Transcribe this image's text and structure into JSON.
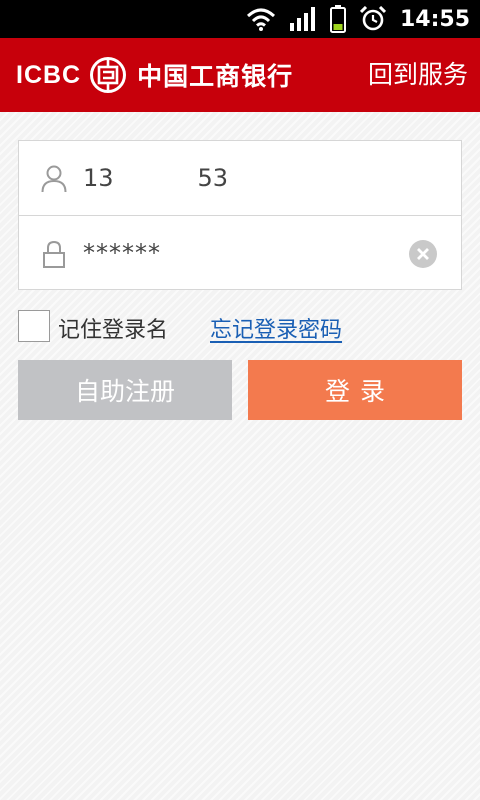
{
  "status_bar": {
    "time": "14:55",
    "icons": [
      "wifi-icon",
      "signal-icon",
      "battery-icon",
      "alarm-icon"
    ]
  },
  "header": {
    "brand_latin": "ICBC",
    "brand_logo": "icbc-logo-icon",
    "brand_name": "中国工商银行",
    "back_link": "回到服务"
  },
  "form": {
    "username_value": "13           53",
    "password_value": "******",
    "username_icon": "user-icon",
    "password_icon": "lock-icon",
    "clear_icon": "clear-icon"
  },
  "options": {
    "remember_label": "记住登录名",
    "remember_checked": false,
    "forgot_link": "忘记登录密码"
  },
  "buttons": {
    "register_label": "自助注册",
    "login_label": "登录"
  },
  "colors": {
    "header_bg": "#c7000b",
    "login_button": "#f37a4e",
    "register_button": "#c1c2c5",
    "link": "#1a5fb4"
  }
}
